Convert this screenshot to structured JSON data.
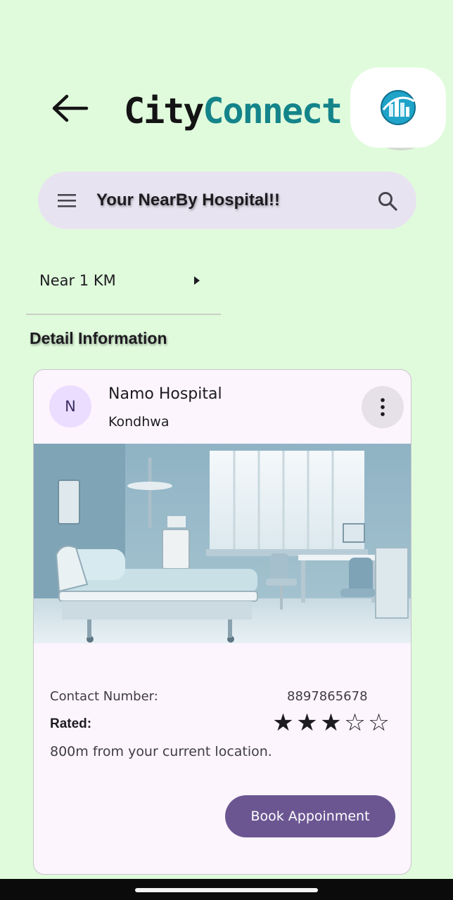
{
  "app": {
    "logo_part1": "City",
    "logo_part2": "Connect",
    "back_icon": "arrow-left-icon",
    "profile_icon": "city-logo-icon"
  },
  "search": {
    "title": "Your NearBy Hospital!!",
    "menu_icon": "hamburger-menu-icon",
    "search_icon": "search-icon"
  },
  "filter": {
    "label": "Near 1 KM",
    "arrow_icon": "caret-right-icon"
  },
  "section": {
    "title": "Detail Information"
  },
  "card": {
    "avatar_initial": "N",
    "title": "Namo Hospital",
    "subtitle": "Kondhwa",
    "more_icon": "more-vertical-icon",
    "image_alt": "hospital-room-photo",
    "contact_label": "Contact Number:",
    "contact_number": "8897865678",
    "rated_label": "Rated:",
    "rating": 3,
    "rating_max": 5,
    "distance_text": "800m from your current location.",
    "book_button": "Book Appoinment"
  },
  "colors": {
    "background": "#e0fbdc",
    "logo_accent": "#14848a",
    "search_bar": "#e8e3f0",
    "card_bg": "#fcf5fd",
    "button": "#6b5692",
    "avatar_bg": "#eaddff"
  }
}
